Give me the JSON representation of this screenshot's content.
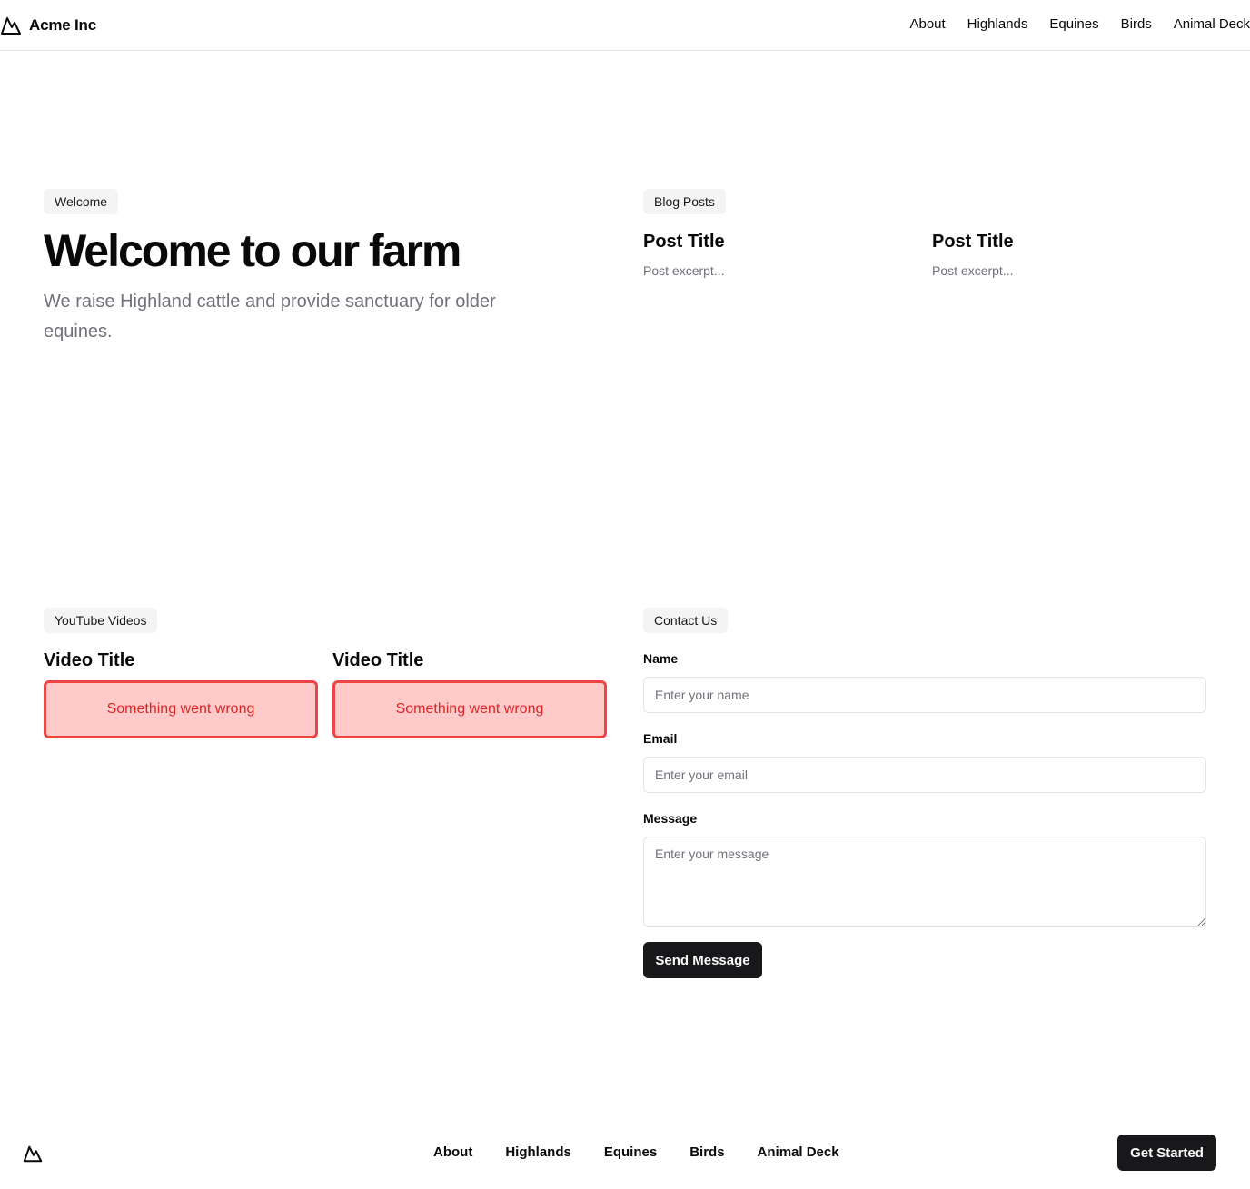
{
  "header": {
    "brand": "Acme Inc",
    "logo_icon": "mountain-icon",
    "nav": [
      "About",
      "Highlands",
      "Equines",
      "Birds",
      "Animal Deck"
    ]
  },
  "hero": {
    "badge": "Welcome",
    "title": "Welcome to our farm",
    "subtitle": "We raise Highland cattle and provide sanctuary for older equines."
  },
  "blog": {
    "badge": "Blog Posts",
    "posts": [
      {
        "title": "Post Title",
        "excerpt": "Post excerpt..."
      },
      {
        "title": "Post Title",
        "excerpt": "Post excerpt..."
      }
    ]
  },
  "videos": {
    "badge": "YouTube Videos",
    "items": [
      {
        "title": "Video Title",
        "error": "Something went wrong"
      },
      {
        "title": "Video Title",
        "error": "Something went wrong"
      }
    ]
  },
  "contact": {
    "badge": "Contact Us",
    "name_label": "Name",
    "name_placeholder": "Enter your name",
    "email_label": "Email",
    "email_placeholder": "Enter your email",
    "message_label": "Message",
    "message_placeholder": "Enter your message",
    "submit": "Send Message"
  },
  "footer": {
    "logo_icon": "mountain-icon",
    "nav": [
      "About",
      "Highlands",
      "Equines",
      "Birds",
      "Animal Deck"
    ],
    "cta": "Get Started"
  },
  "colors": {
    "primary": "#18181b",
    "muted_text": "#71717a",
    "badge_bg": "#f4f4f5",
    "error_border": "#ef4444",
    "error_bg": "#fecaca",
    "error_text": "#dc2626"
  }
}
